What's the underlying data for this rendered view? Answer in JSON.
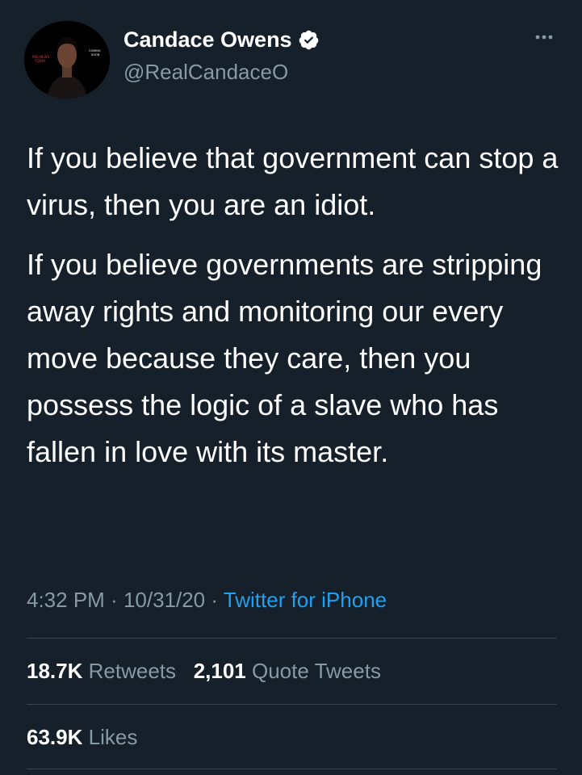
{
  "author": {
    "name": "Candace Owens",
    "handle": "@RealCandaceO",
    "verified": true,
    "avatar_icon": "profile-photo"
  },
  "tweet": {
    "paragraphs": [
      "If you believe that government can stop a virus, then you are an idiot.",
      "If you believe governments are stripping away rights and monitoring our every move because they care, then you possess the logic of a slave who has fallen in love with its master."
    ]
  },
  "meta": {
    "time": "4:32 PM",
    "separator": " · ",
    "date": "10/31/20",
    "source": "Twitter for iPhone"
  },
  "stats": {
    "retweets_count": "18.7K",
    "retweets_label": "Retweets",
    "quotes_count": "2,101",
    "quotes_label": "Quote Tweets",
    "likes_count": "63.9K",
    "likes_label": "Likes"
  },
  "colors": {
    "background": "#15202b",
    "text": "#ffffff",
    "secondary": "#8899a6",
    "accent": "#1da1f2",
    "divider": "#38444d"
  },
  "icons": {
    "verified": "verified-badge-icon",
    "more": "more-options-icon"
  }
}
